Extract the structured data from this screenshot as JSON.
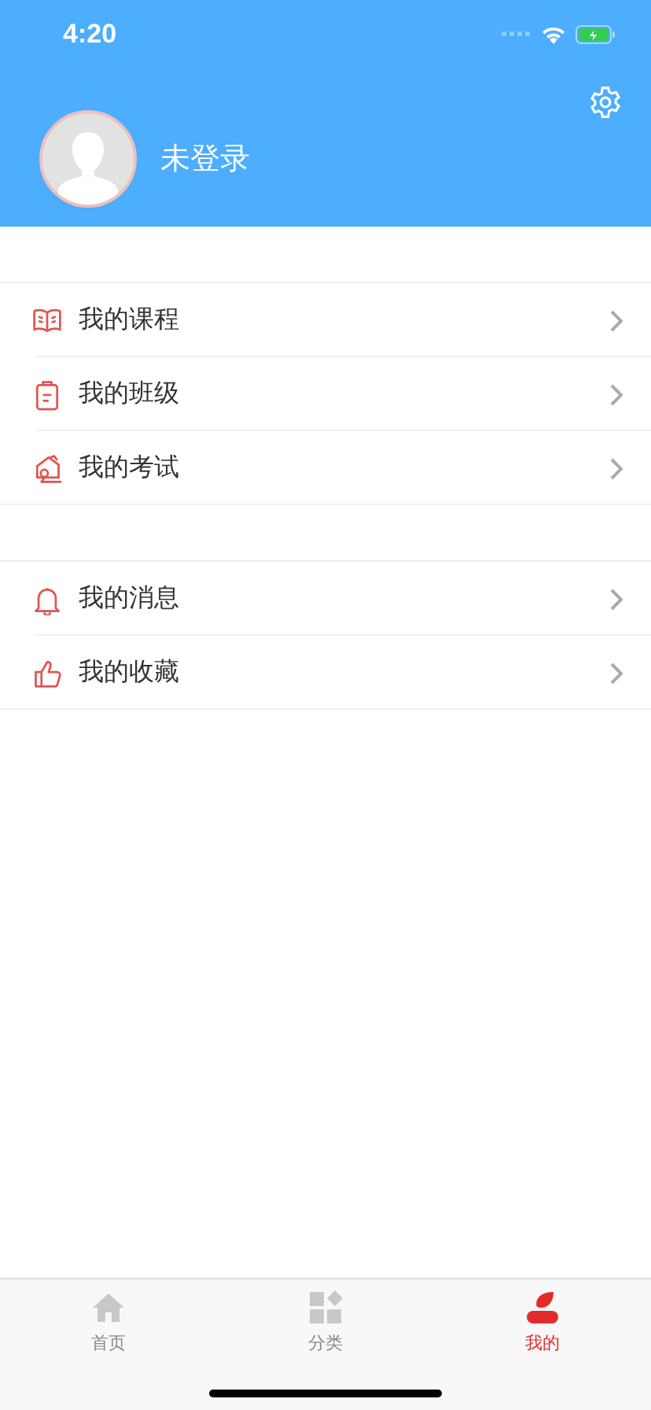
{
  "status_bar": {
    "time": "4:20"
  },
  "profile": {
    "name": "未登录"
  },
  "menu_groups": [
    {
      "items": [
        {
          "kind": "book",
          "label": "我的课程"
        },
        {
          "kind": "clipboard",
          "label": "我的班级"
        },
        {
          "kind": "exam",
          "label": "我的考试"
        }
      ]
    },
    {
      "items": [
        {
          "kind": "bell",
          "label": "我的消息"
        },
        {
          "kind": "thumb",
          "label": "我的收藏"
        }
      ]
    }
  ],
  "tab_bar": [
    {
      "kind": "home",
      "label": "首页",
      "selected": false
    },
    {
      "kind": "grid",
      "label": "分类",
      "selected": false
    },
    {
      "kind": "person",
      "label": "我的",
      "selected": true
    }
  ]
}
